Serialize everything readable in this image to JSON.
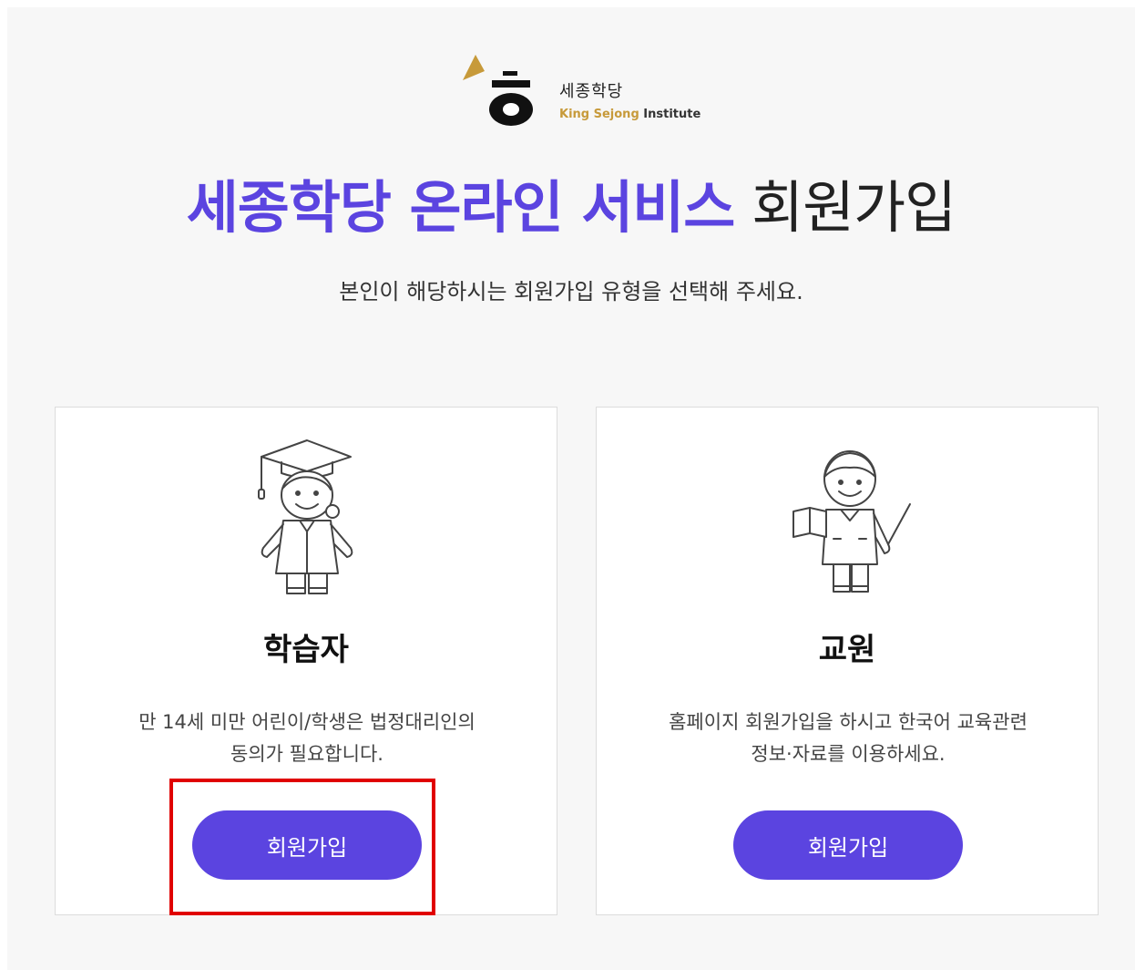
{
  "logo": {
    "korean": "세종학당",
    "english_gold": "King Sejong",
    "english_dark": "Institute",
    "gold_color": "#c79a3a"
  },
  "header": {
    "title_accent": "세종학당 온라인 서비스",
    "title_rest": "회원가입",
    "subtitle": "본인이 해당하시는 회원가입 유형을 선택해 주세요.",
    "accent_color": "#5b44e0"
  },
  "cards": [
    {
      "icon": "student-graduate-icon",
      "title": "학습자",
      "desc_line1": "만 14세 미만 어린이/학생은 법정대리인의",
      "desc_line2": "동의가 필요합니다.",
      "button_label": "회원가입"
    },
    {
      "icon": "teacher-icon",
      "title": "교원",
      "desc_line1": "홈페이지 회원가입을 하시고 한국어 교육관련",
      "desc_line2": "정보·자료를 이용하세요.",
      "button_label": "회원가입"
    }
  ],
  "highlight_color": "#e00000"
}
